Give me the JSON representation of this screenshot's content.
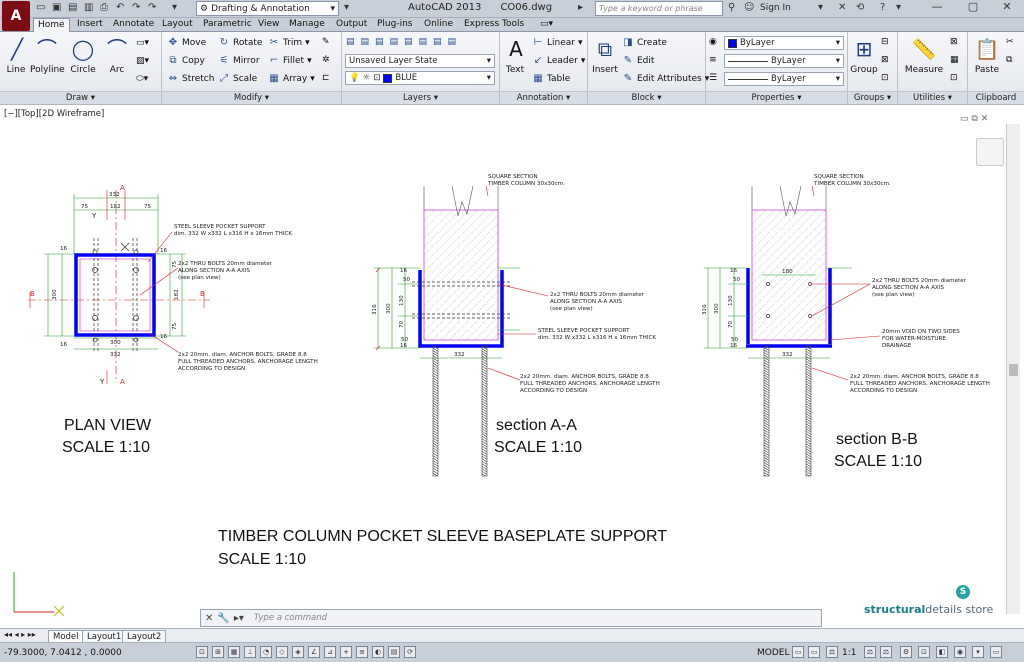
{
  "titlebar": {
    "workspace": "Drafting & Annotation",
    "app_name": "AutoCAD 2013",
    "file_name": "CO06.dwg",
    "search_placeholder": "Type a keyword or phrase",
    "sign_in": "Sign In"
  },
  "tabs": [
    "Home",
    "Insert",
    "Annotate",
    "Layout",
    "Parametric",
    "View",
    "Manage",
    "Output",
    "Plug-ins",
    "Online",
    "Express Tools"
  ],
  "ribbon": {
    "draw": {
      "title": "Draw",
      "tools": [
        "Line",
        "Polyline",
        "Circle",
        "Arc"
      ]
    },
    "modify": {
      "title": "Modify",
      "tools": [
        "Move",
        "Rotate",
        "Trim",
        "Copy",
        "Mirror",
        "Fillet",
        "Stretch",
        "Scale",
        "Array"
      ]
    },
    "layers": {
      "title": "Layers",
      "layer_state": "Unsaved Layer State",
      "current_layer": "BLUE"
    },
    "annotation": {
      "title": "Annotation",
      "text": "Text",
      "linear": "Linear",
      "leader": "Leader",
      "table": "Table"
    },
    "block": {
      "title": "Block",
      "insert": "Insert",
      "create": "Create",
      "edit": "Edit",
      "edit_attributes": "Edit Attributes"
    },
    "properties": {
      "title": "Properties",
      "color": "ByLayer",
      "linetype": "ByLayer",
      "lineweight": "ByLayer"
    },
    "groups": {
      "title": "Groups",
      "group": "Group"
    },
    "utilities": {
      "title": "Utilities",
      "measure": "Measure"
    },
    "clipboard": {
      "title": "Clipboard",
      "paste": "Paste"
    },
    "colors": {
      "layer_color": "#0000ff"
    }
  },
  "viewport": {
    "label": "[−][Top][2D Wireframe]"
  },
  "drawing": {
    "plan": {
      "dims": [
        "332",
        "75",
        "182",
        "75",
        "16",
        "300",
        "16",
        "75",
        "182",
        "75",
        "300",
        "332",
        "16",
        "16"
      ],
      "marks": [
        "Y",
        "B",
        "B",
        "A",
        "A",
        "Y"
      ],
      "notes": [
        "STEEL SLEEVE POCKET SUPPORT",
        "dim. 332 W x332 L x316 H x 16mm THICK",
        "2x2 THRU BOLTS 20mm diameter",
        "ALONG SECTION A-A AXIS",
        "(see plan view)",
        "2x2 20mm. diam. ANCHOR BOLTS, GRADE 8.8",
        "FULL THREADED ANCHORS, ANCHORAGE LENGTH",
        "ACCORDING TO DESIGN"
      ],
      "label1": "PLAN VIEW",
      "label2": "SCALE 1:10"
    },
    "section_a": {
      "notes": [
        "SQUARE SECTION",
        "TIMBER COLUMN 30x30cm.",
        "2x2 THRU BOLTS 20mm diameter",
        "ALONG SECTION A-A AXIS",
        "(see plan view)",
        "STEEL SLEEVE POCKET SUPPORT",
        "dim. 332 W x332 L x316 H x 16mm THICK",
        "2x2 20mm. diam. ANCHOR BOLTS, GRADE 8.8",
        "FULL THREADED ANCHORS, ANCHORAGE LENGTH",
        "ACCORDING TO DESIGN"
      ],
      "dims": [
        "316",
        "300",
        "16",
        "50",
        "130",
        "70",
        "50",
        "16",
        "332"
      ],
      "label1": "section A-A",
      "label2": "SCALE 1:10"
    },
    "section_b": {
      "notes": [
        "SQUARE SECTION",
        "TIMBER COLUMN 30x30cm.",
        "2x2 THRU BOLTS 20mm diameter",
        "ALONG SECTION A-A AXIS",
        "(see plan view)",
        "20mm VOID ON TWO SIDES",
        "FOR WATER-MOISTURE",
        "DRAINAGE",
        "2x2 20mm. diam. ANCHOR BOLTS, GRADE 8.8",
        "FULL THREADED ANCHORS, ANCHORAGE LENGTH",
        "ACCORDING TO DESIGN"
      ],
      "dims": [
        "316",
        "300",
        "16",
        "50",
        "130",
        "70",
        "50",
        "16",
        "180",
        "332"
      ],
      "label1": "section B-B",
      "label2": "SCALE 1:10"
    },
    "main_title": "TIMBER COLUMN POCKET SLEEVE BASEPLATE SUPPORT",
    "main_scale": "SCALE 1:10"
  },
  "command": {
    "placeholder": "Type  a  command"
  },
  "brand": {
    "logo": "S",
    "part1": "structural",
    "part2": "details store"
  },
  "layout_tabs": [
    "Model",
    "Layout1",
    "Layout2"
  ],
  "status": {
    "coords": "-79.3000, 7.0412 , 0.0000",
    "model": "MODEL",
    "scale": "1:1"
  }
}
